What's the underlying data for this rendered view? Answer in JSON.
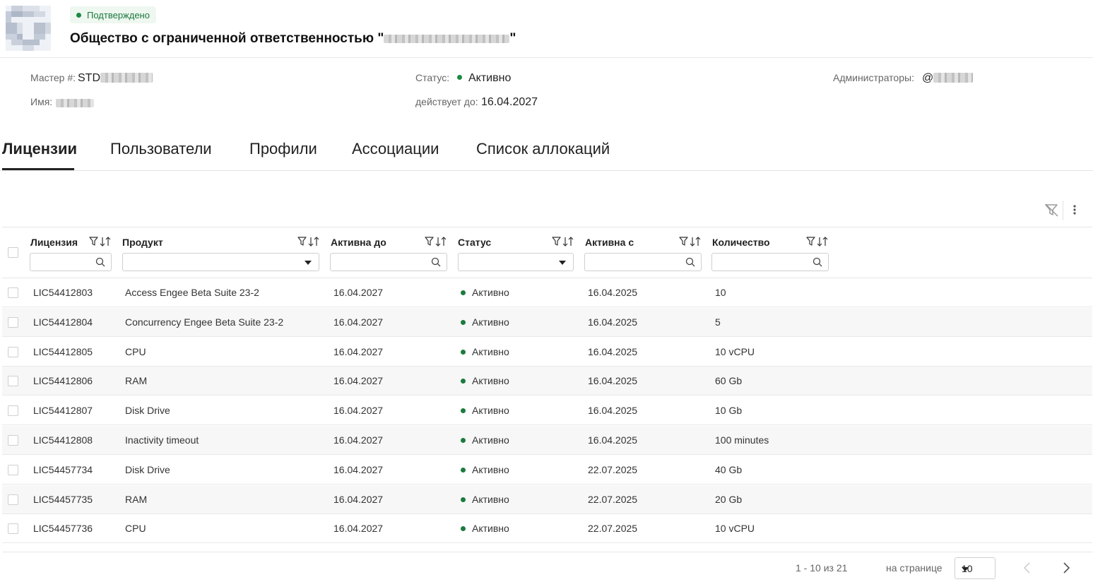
{
  "header": {
    "badge": "Подтверждено",
    "org_title": "Общество с ограниченной ответственностью \"",
    "org_title_end": "\""
  },
  "info": {
    "master_label": "Мастер #:",
    "master_prefix": "STD",
    "name_label": "Имя:",
    "status_label": "Статус:",
    "status_value": "Активно",
    "valid_label": "действует до:",
    "valid_value": "16.04.2027",
    "admins_label": "Администраторы:",
    "admins_prefix": "@"
  },
  "tabs": [
    {
      "label": "Лицензии",
      "active": true
    },
    {
      "label": "Пользователи",
      "active": false
    },
    {
      "label": "Профили",
      "active": false
    },
    {
      "label": "Ассоциации",
      "active": false
    },
    {
      "label": "Список аллокаций",
      "active": false
    }
  ],
  "columns": {
    "license": "Лицензия",
    "product": "Продукт",
    "active_until": "Активна до",
    "status": "Статус",
    "active_from": "Активна с",
    "quantity": "Количество"
  },
  "rows": [
    {
      "license": "LIC54412803",
      "product": "Access Engee Beta Suite 23-2",
      "until": "16.04.2027",
      "status": "Активно",
      "from": "16.04.2025",
      "qty": "10"
    },
    {
      "license": "LIC54412804",
      "product": "Concurrency Engee Beta Suite 23-2",
      "until": "16.04.2027",
      "status": "Активно",
      "from": "16.04.2025",
      "qty": "5"
    },
    {
      "license": "LIC54412805",
      "product": "CPU",
      "until": "16.04.2027",
      "status": "Активно",
      "from": "16.04.2025",
      "qty": "10 vCPU"
    },
    {
      "license": "LIC54412806",
      "product": "RAM",
      "until": "16.04.2027",
      "status": "Активно",
      "from": "16.04.2025",
      "qty": "60 Gb"
    },
    {
      "license": "LIC54412807",
      "product": "Disk Drive",
      "until": "16.04.2027",
      "status": "Активно",
      "from": "16.04.2025",
      "qty": "10 Gb"
    },
    {
      "license": "LIC54412808",
      "product": "Inactivity timeout",
      "until": "16.04.2027",
      "status": "Активно",
      "from": "16.04.2025",
      "qty": "100 minutes"
    },
    {
      "license": "LIC54457734",
      "product": "Disk Drive",
      "until": "16.04.2027",
      "status": "Активно",
      "from": "22.07.2025",
      "qty": "40 Gb"
    },
    {
      "license": "LIC54457735",
      "product": "RAM",
      "until": "16.04.2027",
      "status": "Активно",
      "from": "22.07.2025",
      "qty": "20 Gb"
    },
    {
      "license": "LIC54457736",
      "product": "CPU",
      "until": "16.04.2027",
      "status": "Активно",
      "from": "22.07.2025",
      "qty": "10 vCPU"
    }
  ],
  "footer": {
    "range": "1 - 10 из 21",
    "per_page_label": "на странице",
    "per_page_value": "10"
  },
  "colors": {
    "status_green": "#1c8a43",
    "badge_bg": "#eef7f0"
  }
}
